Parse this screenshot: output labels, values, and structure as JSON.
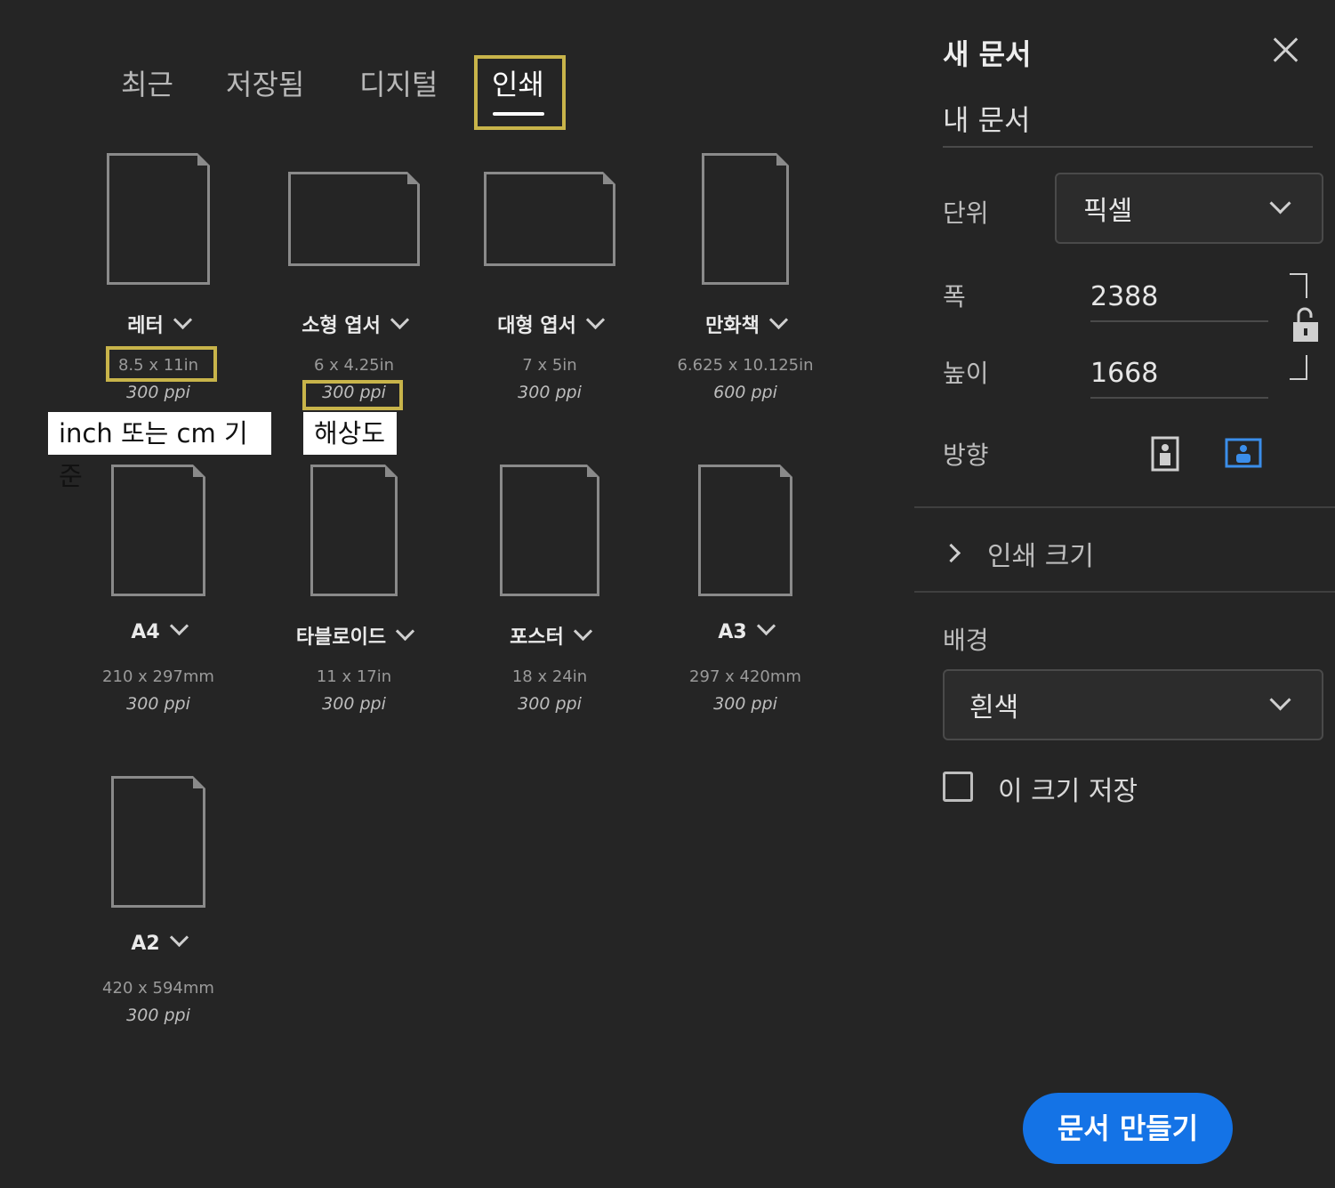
{
  "tabs": [
    {
      "label": "최근"
    },
    {
      "label": "저장됨"
    },
    {
      "label": "디지털"
    },
    {
      "label": "인쇄"
    }
  ],
  "presets": [
    {
      "name": "레터",
      "size": "8.5 x 11in",
      "ppi": "300 ppi"
    },
    {
      "name": "소형 엽서",
      "size": "6 x 4.25in",
      "ppi": "300 ppi"
    },
    {
      "name": "대형 엽서",
      "size": "7 x 5in",
      "ppi": "300 ppi"
    },
    {
      "name": "만화책",
      "size": "6.625 x 10.125in",
      "ppi": "600 ppi"
    },
    {
      "name": "A4",
      "size": "210 x 297mm",
      "ppi": "300 ppi"
    },
    {
      "name": "타블로이드",
      "size": "11 x 17in",
      "ppi": "300 ppi"
    },
    {
      "name": "포스터",
      "size": "18 x 24in",
      "ppi": "300 ppi"
    },
    {
      "name": "A3",
      "size": "297 x 420mm",
      "ppi": "300 ppi"
    },
    {
      "name": "A2",
      "size": "420 x 594mm",
      "ppi": "300 ppi"
    }
  ],
  "annotations": {
    "units_note": "inch 또는 cm 기준",
    "resolution_note": "해상도"
  },
  "panel": {
    "title": "새 문서",
    "doc_name": "내 문서",
    "unit_label": "단위",
    "unit_value": "픽셀",
    "width_label": "폭",
    "width_value": "2388",
    "height_label": "높이",
    "height_value": "1668",
    "orientation_label": "방향",
    "print_size_label": "인쇄 크기",
    "background_label": "배경",
    "background_value": "흰색",
    "save_size_label": "이 크기 저장",
    "create_button": "문서 만들기"
  },
  "colors": {
    "background": "#252525",
    "highlight": "#c8b44a",
    "accent": "#1473e6"
  },
  "icons": {
    "close": "close-icon",
    "lock": "unlock-icon",
    "portrait": "portrait-icon",
    "landscape": "landscape-icon",
    "chevron": "chevron-down-icon",
    "expand": "chevron-right-icon"
  }
}
